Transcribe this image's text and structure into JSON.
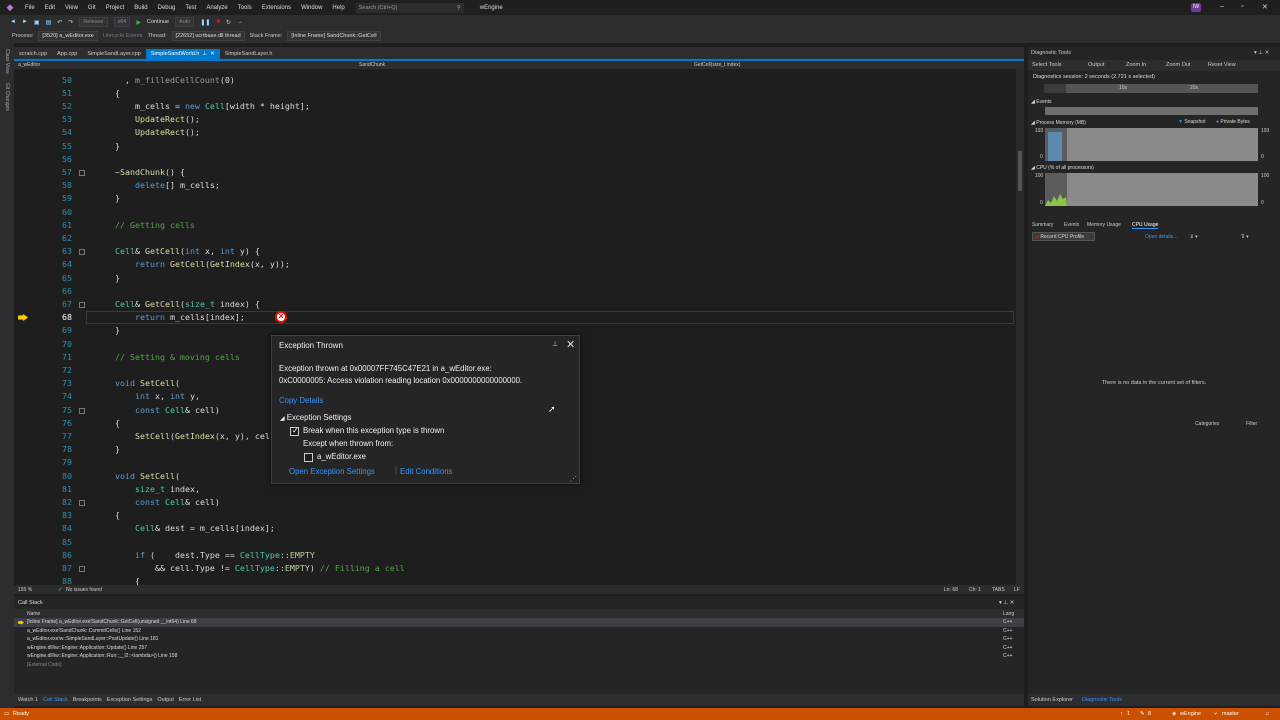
{
  "menu": {
    "items": [
      "File",
      "Edit",
      "View",
      "Git",
      "Project",
      "Build",
      "Debug",
      "Test",
      "Analyze",
      "Tools",
      "Extensions",
      "Window",
      "Help"
    ],
    "search_placeholder": "Search (Ctrl+Q)",
    "solution": "wEngine",
    "avatar": "IW"
  },
  "toolbar": {
    "config": "Release",
    "platform": "x64",
    "continue_label": "Continue",
    "auto_label": "Auto"
  },
  "procbar": {
    "process_label": "Process:",
    "process_value": "[3520] a_wEditor.exe",
    "lifecycle_label": "Lifecycle Events",
    "thread_label": "Thread:",
    "thread_value": "[22652] ucrtbase.dll thread",
    "stackframe_label": "Stack Frame:",
    "stackframe_value": "[Inline Frame] SandChunk::GetCell"
  },
  "leftstrip": {
    "a": "Class View",
    "b": "Git Changes"
  },
  "tabs": [
    {
      "label": "scratch.cpp",
      "active": false
    },
    {
      "label": "App.cpp",
      "active": false
    },
    {
      "label": "SimpleSandLayer.cpp",
      "active": false
    },
    {
      "label": "SimpleSandWorld.h",
      "active": true
    },
    {
      "label": "SimpleSandLayer.h",
      "active": false
    }
  ],
  "navbar": {
    "project": "a_wEditor",
    "scope": "SandChunk",
    "member": "GetCell(size_t index)"
  },
  "code_lines": [
    {
      "n": "50"
    },
    {
      "n": "51"
    },
    {
      "n": "52"
    },
    {
      "n": "53"
    },
    {
      "n": "54"
    },
    {
      "n": "55"
    },
    {
      "n": "56"
    },
    {
      "n": "57"
    },
    {
      "n": "58"
    },
    {
      "n": "59"
    },
    {
      "n": "60"
    },
    {
      "n": "61"
    },
    {
      "n": "62"
    },
    {
      "n": "63"
    },
    {
      "n": "64"
    },
    {
      "n": "65"
    },
    {
      "n": "66"
    },
    {
      "n": "67"
    },
    {
      "n": "68"
    },
    {
      "n": "69"
    },
    {
      "n": "70"
    },
    {
      "n": "71"
    },
    {
      "n": "72"
    },
    {
      "n": "73"
    },
    {
      "n": "74"
    },
    {
      "n": "75"
    },
    {
      "n": "76"
    },
    {
      "n": "77"
    },
    {
      "n": "78"
    },
    {
      "n": "79"
    },
    {
      "n": "80"
    },
    {
      "n": "81"
    },
    {
      "n": "82"
    },
    {
      "n": "83"
    },
    {
      "n": "84"
    },
    {
      "n": "85"
    },
    {
      "n": "86"
    },
    {
      "n": "87"
    },
    {
      "n": "88"
    }
  ],
  "exception": {
    "title": "Exception Thrown",
    "message_line1": "Exception thrown at 0x00007FF745C47E21 in a_wEditor.exe:",
    "message_line2": "0xC0000005: Access violation reading location 0x0000000000000000.",
    "copy_details": "Copy Details",
    "settings_header": "Exception Settings",
    "break_label": "Break when this exception type is thrown",
    "except_label": "Except when thrown from:",
    "module_label": "a_wEditor.exe",
    "open_settings": "Open Exception Settings",
    "edit_conditions": "Edit Conditions"
  },
  "editor_status": {
    "zoom": "155 %",
    "issues": "No issues found",
    "ln": "Ln: 68",
    "ch": "Ch: 1",
    "tabs": "TABS",
    "eol": "LF"
  },
  "callstack": {
    "title": "Call Stack",
    "col_name": "Name",
    "col_lang": "Lang",
    "rows": [
      {
        "name": "[Inline Frame] a_wEditor.exe!SandChunk::GetCell(unsigned __int64) Line 68",
        "lang": "C++"
      },
      {
        "name": "a_wEditor.exe!SandChunk::CommitCells() Line 152",
        "lang": "C++"
      },
      {
        "name": "a_wEditor.exe!w::SimpleSandLayer::PostUpdate() Line 181",
        "lang": "C++"
      },
      {
        "name": "wEngine.dll!iw::Engine::Application::Update() Line 257",
        "lang": "C++"
      },
      {
        "name": "wEngine.dll!iw::Engine::Application::Run::__l2::<lambda>() Line 158",
        "lang": "C++"
      },
      {
        "name": "[External Code]",
        "lang": ""
      }
    ]
  },
  "bottom_tabs": [
    "Watch 1",
    "Call Stack",
    "Breakpoints",
    "Exception Settings",
    "Output",
    "Error List"
  ],
  "diag": {
    "title": "Diagnostic Tools",
    "select_tools": "Select Tools",
    "output": "Output",
    "zoom_in": "Zoom In",
    "zoom_out": "Zoom Out",
    "reset_view": "Reset View",
    "session": "Diagnostics session: 2 seconds (2.721 s selected)",
    "tick1": "10s",
    "tick2": "20s",
    "events": "Events",
    "memory": "Process Memory (MB)",
    "snapshot": "Snapshot",
    "private_bytes": "Private Bytes",
    "mem_max": "193",
    "mem_min": "0",
    "cpu": "CPU (% of all processors)",
    "cpu_max": "100",
    "cpu_min": "0",
    "tab_summary": "Summary",
    "tab_events": "Events",
    "tab_memory": "Memory Usage",
    "tab_cpu": "CPU Usage",
    "record": "Record CPU Profile",
    "open_details": "Open details...",
    "categories": "Categories",
    "filter": "Filter",
    "nodata": "There is no data in the current set of filters.",
    "solution_explorer": "Solution Explorer",
    "diag_tab": "Diagnostic Tools"
  },
  "statusbar": {
    "ready": "Ready",
    "up": "1",
    "pencil": "8",
    "project": "wEngine",
    "branch": "master"
  }
}
